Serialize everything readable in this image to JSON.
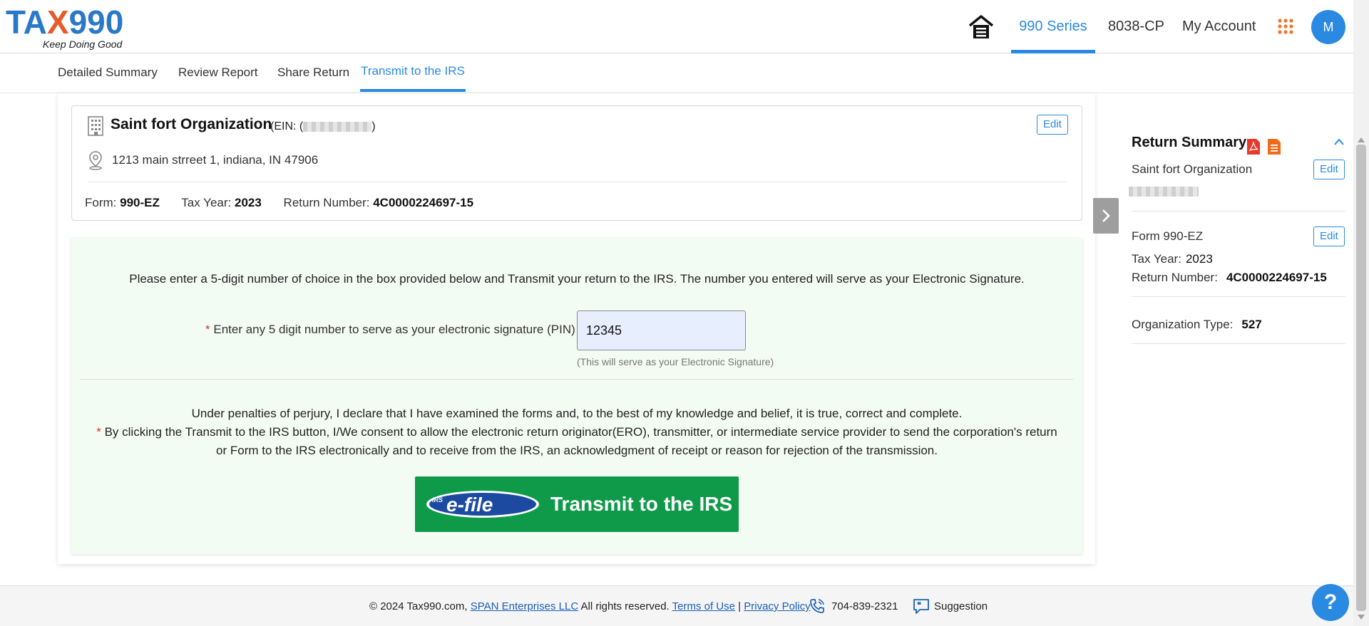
{
  "header": {
    "logo_main_left": "TA",
    "logo_main_x": "X",
    "logo_main_right": "990",
    "logo_tagline": "Keep Doing Good",
    "nav": [
      "990 Series",
      "8038-CP",
      "My Account"
    ],
    "avatar_initial": "M"
  },
  "subnav": {
    "tabs": [
      "Detailed Summary",
      "Review Report",
      "Share Return",
      "Transmit to the IRS"
    ],
    "active_tab": "Transmit to the IRS"
  },
  "org_card": {
    "name": "Saint fort Organization",
    "ein_prefix": "(EIN: (",
    "ein_suffix": ")",
    "edit_label": "Edit",
    "address": "1213 main strreet 1, indiana, IN 47906",
    "form_label": "Form:",
    "form_value": "990-EZ",
    "tax_year_label": "Tax Year:",
    "tax_year_value": "2023",
    "return_number_label": "Return Number:",
    "return_number_value": "4C0000224697-15"
  },
  "signature": {
    "instruction": "Please enter a 5-digit number of choice in the box provided below and Transmit your return to the IRS. The number you entered will serve as your Electronic Signature.",
    "required_mark": "*",
    "pin_label": "Enter any 5 digit number to serve as your electronic signature (PIN)",
    "pin_value": "12345",
    "pin_hint": "(This will serve as your Electronic Signature)",
    "declaration_1": "Under penalties of perjury, I declare that I have examined the forms and, to the best of my knowledge and belief, it is true, correct and complete.",
    "declaration_2": "By clicking the Transmit to the IRS button, I/We consent to allow the electronic return originator(ERO), transmitter, or intermediate service provider to send the corporation's return or Form to the IRS electronically and to receive from the IRS, an acknowledgment of receipt or reason for rejection of the transmission.",
    "transmit_label": "Transmit to the IRS",
    "efile_logo_irs": "IRS",
    "efile_logo_text": "e-file"
  },
  "sidebar": {
    "title": "Return Summary",
    "org_name": "Saint fort Organization",
    "edit_label": "Edit",
    "form_text": "Form 990-EZ",
    "tax_year_label": "Tax Year:",
    "tax_year_value": "2023",
    "return_number_label": "Return Number:",
    "return_number_value": "4C0000224697-15",
    "org_type_label": "Organization Type:",
    "org_type_value": "527"
  },
  "footer": {
    "copyright": "© 2024 Tax990.com,",
    "company_link": "SPAN Enterprises LLC",
    "rights": "All rights reserved.",
    "terms_link": "Terms of Use",
    "separator": "|",
    "privacy_link": "Privacy Policy",
    "phone": "704-839-2321",
    "suggestion": "Suggestion"
  },
  "help_label": "?",
  "colors": {
    "accent": "#2a8ae2",
    "transmit_green": "#0f9a4a",
    "required_red": "#e0302a",
    "panel_green": "#f3fcf3"
  },
  "icons": [
    "home-icon",
    "apps-grid-icon",
    "building-icon",
    "location-pin-icon",
    "chevron-right-icon",
    "pdf-icon",
    "document-icon",
    "chevron-up-icon",
    "phone-icon",
    "suggestion-icon",
    "help-icon"
  ]
}
